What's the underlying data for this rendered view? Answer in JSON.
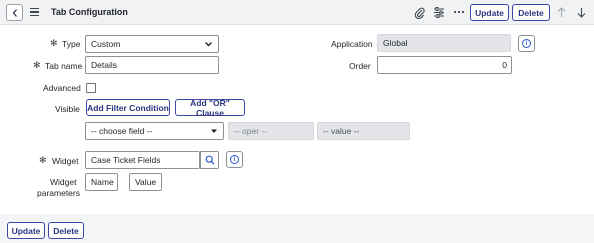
{
  "header": {
    "title": "Tab Configuration",
    "update_label": "Update",
    "delete_label": "Delete"
  },
  "form": {
    "type": {
      "label": "Type",
      "value": "Custom"
    },
    "tab_name": {
      "label": "Tab name",
      "value": "Details"
    },
    "advanced": {
      "label": "Advanced",
      "checked": false
    },
    "visible": {
      "label": "Visible",
      "add_filter_label": "Add Filter Condition",
      "add_or_label": "Add \"OR\" Clause",
      "field_value": "-- choose field --",
      "oper_value": "-- oper --",
      "value_value": "-- value --"
    },
    "application": {
      "label": "Application",
      "value": "Global"
    },
    "order": {
      "label": "Order",
      "value": "0"
    },
    "widget": {
      "label": "Widget",
      "value": "Case Ticket Fields"
    },
    "widget_parameters": {
      "label_line1": "Widget",
      "label_line2": "parameters",
      "name_placeholder": "Name",
      "value_placeholder": "Value"
    }
  },
  "footer": {
    "update_label": "Update",
    "delete_label": "Delete"
  },
  "icons": {
    "back": "chevron-left-icon",
    "menu": "hamburger-menu-icon",
    "attachment": "paperclip-icon",
    "settings": "sliders-icon",
    "more": "ellipsis-icon",
    "prev": "arrow-up-icon",
    "next": "arrow-down-icon",
    "info": "info-icon",
    "search": "search-icon",
    "required": "required-asterisk-icon"
  },
  "colors": {
    "accent": "#2b357f",
    "header_bg": "#f1f2f4",
    "readonly_bg": "#e3e5e8"
  }
}
